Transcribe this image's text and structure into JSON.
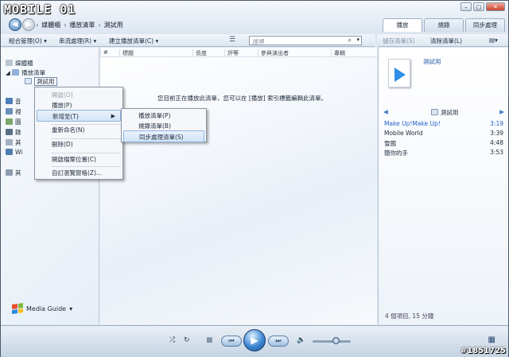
{
  "watermark_top": "MOBILE 01",
  "watermark_bottom": "#1851725",
  "nav": {
    "breadcrumb": [
      "媒體櫃",
      "播放清單",
      "測試用"
    ],
    "separator": "›"
  },
  "tabs": [
    {
      "label": "播放",
      "active": true
    },
    {
      "label": "燒錄",
      "active": false
    },
    {
      "label": "同步處理",
      "active": false
    }
  ],
  "toolbar": {
    "organize": "組合管理(O) ▾",
    "stream": "串流處理(R) ▾",
    "create_playlist": "建立播放清單(C) ▾",
    "search_placeholder": "搜尋",
    "save_list": "儲存清單(S)",
    "clear_list": "清除清單(L)"
  },
  "sidebar": {
    "items": [
      {
        "label": "媒體櫃",
        "icon": "library-icon"
      },
      {
        "label": "播放清單",
        "icon": "playlist-icon"
      },
      {
        "label": "測試用",
        "icon": "playlist-file-icon"
      },
      {
        "label": "音",
        "icon": "music-icon"
      },
      {
        "label": "視",
        "icon": "video-icon"
      },
      {
        "label": "圖",
        "icon": "picture-icon"
      },
      {
        "label": "錄",
        "icon": "recorded-tv-icon"
      },
      {
        "label": "其",
        "icon": "other-media-icon"
      },
      {
        "label": "Wi",
        "icon": "network-icon"
      },
      {
        "label": "其",
        "icon": "other-libraries-icon"
      }
    ],
    "media_guide": "Media Guide"
  },
  "columns": [
    "#",
    "標題",
    "長度",
    "評等",
    "參與演出者",
    "專輯"
  ],
  "empty_message": "您目前正在播放此清單，您可以在 [播放] 索引標籤編輯此清單。",
  "context_menu": {
    "items": [
      {
        "label": "開啟(O)",
        "disabled": true
      },
      {
        "label": "播放(P)",
        "disabled": false
      },
      {
        "label": "新增至(T)",
        "disabled": false,
        "submenu": true
      },
      {
        "label": "重新命名(N)",
        "disabled": false
      },
      {
        "label": "刪除(D)",
        "disabled": false
      },
      {
        "label": "開啟檔案位置(C)",
        "disabled": false
      },
      {
        "label": "自訂瀏覽窗格(Z)...",
        "disabled": false
      }
    ]
  },
  "submenu": {
    "items": [
      "播放清單(P)",
      "燒錄清單(B)",
      "同步處理清單(S)"
    ]
  },
  "right_pane": {
    "playlist_title": "測試用",
    "header": "測試用",
    "tracks": [
      {
        "title": "Make Up!Make Up!",
        "duration": "3:19",
        "active": true
      },
      {
        "title": "Mobile World",
        "duration": "3:39",
        "active": false
      },
      {
        "title": "雪國",
        "duration": "4:48",
        "active": false
      },
      {
        "title": "簡你的手",
        "duration": "3:53",
        "active": false
      }
    ],
    "status": "4 個項目, 15 分鐘"
  },
  "transport": {
    "shuffle": "⤮",
    "repeat": "↻",
    "stop": "■",
    "prev": "⏮",
    "play": "▶",
    "next": "⏭",
    "mute": "🔈",
    "volume": 0.6
  },
  "colors": {
    "accent": "#2f8ee6",
    "active_track": "#1f62c9"
  }
}
